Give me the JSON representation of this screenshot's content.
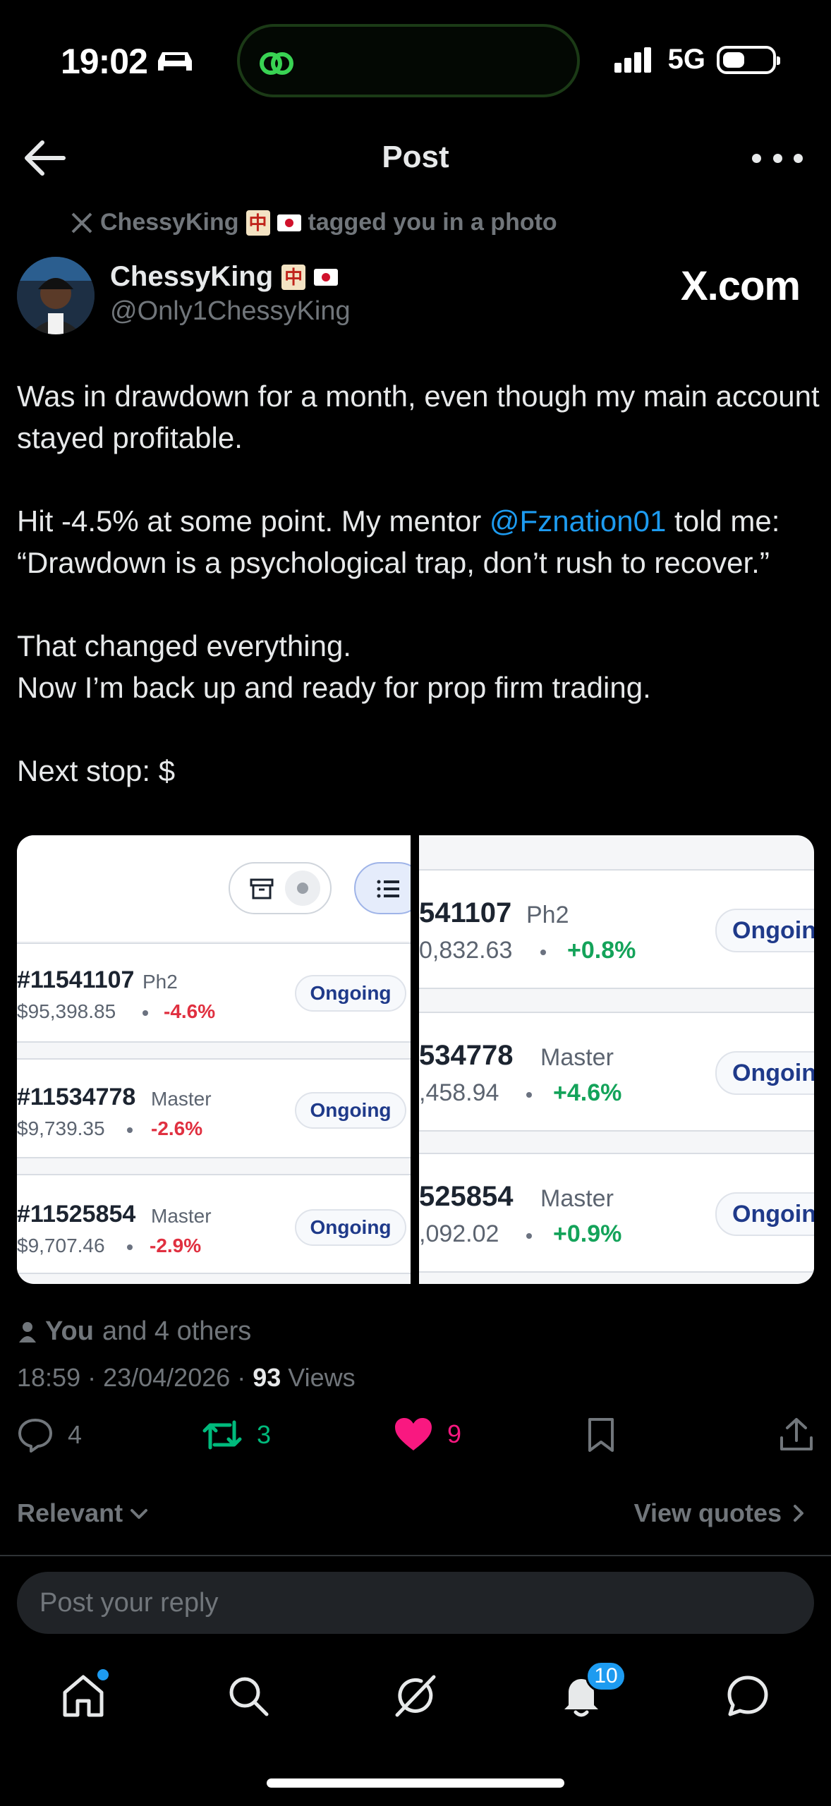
{
  "status_bar": {
    "time": "19:02",
    "network": "5G",
    "battery_level": 0.45
  },
  "header": {
    "title": "Post"
  },
  "post": {
    "tagged": {
      "name": "ChessyKing",
      "text": "tagged you in a photo"
    },
    "author": {
      "name": "ChessyKing",
      "handle": "@Only1ChessyKing"
    },
    "source": "X.com",
    "body": {
      "line1": "Was in drawdown for a month, even though my main account stayed profitable.",
      "line2_pre": "Hit -4.5% at some point. My mentor ",
      "mention": "@Fznation01",
      "line2_post": " told me: “Drawdown is a psychological trap, don’t rush to recover.”",
      "line3a": "That changed everything.",
      "line3b": "Now I’m back up and ready for prop firm trading.",
      "line4": "Next stop: $"
    },
    "media": {
      "left_accounts": [
        {
          "id": "#11541107",
          "phase": "Ph2",
          "balance": "$95,398.85",
          "change": "-4.6%",
          "status": "Ongoing"
        },
        {
          "id": "#11534778",
          "phase": "Master",
          "balance": "$9,739.35",
          "change": "-2.6%",
          "status": "Ongoing"
        },
        {
          "id": "#11525854",
          "phase": "Master",
          "balance": "$9,707.46",
          "change": "-2.9%",
          "status": "Ongoing"
        }
      ],
      "right_accounts": [
        {
          "id": "541107",
          "phase": "Ph2",
          "balance": "0,832.63",
          "change": "+0.8%",
          "status": "Ongoin"
        },
        {
          "id": "534778",
          "phase": "Master",
          "balance": ",458.94",
          "change": "+4.6%",
          "status": "Ongoin"
        },
        {
          "id": "525854",
          "phase": "Master",
          "balance": ",092.02",
          "change": "+0.9%",
          "status": "Ongoin"
        }
      ]
    },
    "likes_summary": {
      "you": "You",
      "others": "and 4 others"
    },
    "meta": {
      "datetime": "18:59 · 23/04/2026 · ",
      "views_count": "93",
      "views_label": " Views"
    },
    "actions": {
      "replies": "4",
      "reposts": "3",
      "likes": "9"
    }
  },
  "replies_section": {
    "filter": "Relevant",
    "view_quotes": "View quotes",
    "reply_placeholder": "Post your reply"
  },
  "bottom_nav": {
    "notifications_badge": "10"
  },
  "colors": {
    "accent": "#1d9bf0",
    "like": "#f91880",
    "repost": "#00ba7c",
    "negative": "#e03040",
    "positive": "#14a35a"
  }
}
